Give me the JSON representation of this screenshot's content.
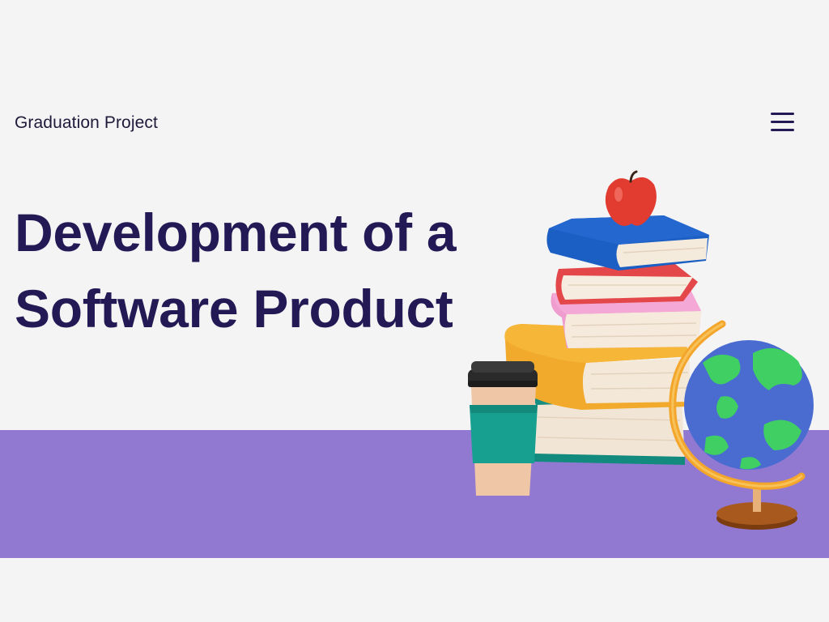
{
  "header": {
    "label": "Graduation Project"
  },
  "menu": {
    "icon": "hamburger-menu-icon"
  },
  "headline": {
    "line1": "Development of a",
    "line2": "Software Product"
  },
  "colors": {
    "background": "#f4f4f4",
    "band": "#9179d2",
    "headline": "#231a55",
    "label": "#1f1a3a"
  },
  "illustration": {
    "subject": "stack-of-books-with-apple-coffee-cup-and-globe"
  }
}
